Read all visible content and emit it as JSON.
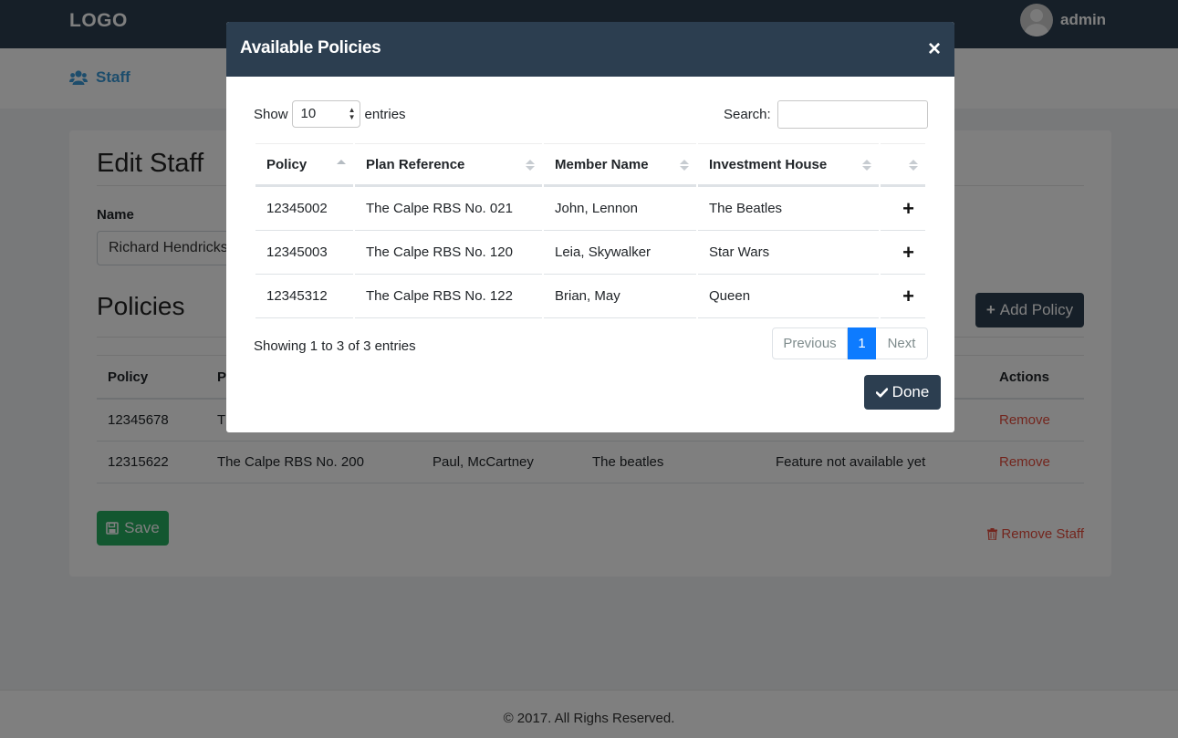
{
  "navbar": {
    "logo": "LOGO",
    "username": "admin"
  },
  "subnav": {
    "crumb_label": "Staff"
  },
  "edit": {
    "title": "Edit Staff",
    "name_label": "Name",
    "name_value": "Richard Hendricks",
    "policies_title": "Policies",
    "add_policy_label": "Add Policy",
    "table_headers": {
      "policy": "Policy",
      "plan_initial": "P",
      "actions": "Actions"
    },
    "rows": [
      {
        "policy": "12345678",
        "plan": "T",
        "member": "",
        "house": "",
        "status": "",
        "action": "Remove"
      },
      {
        "policy": "12315622",
        "plan": "The Calpe RBS No. 200",
        "member": "Paul, McCartney",
        "house": "The beatles",
        "status": "Feature not available yet",
        "action": "Remove"
      }
    ],
    "save_label": "Save",
    "remove_staff_label": "Remove Staff"
  },
  "footer": {
    "text": "© 2017. All Righs Reserved."
  },
  "modal": {
    "title": "Available Policies",
    "close_symbol": "×",
    "show_label": "Show",
    "entries_select": "10",
    "entries_label": "entries",
    "search_label": "Search:",
    "search_value": "",
    "columns": [
      "Policy",
      "Plan Reference",
      "Member Name",
      "Investment House",
      ""
    ],
    "rows": [
      {
        "policy": "12345002",
        "plan": "The Calpe RBS No. 021",
        "member": "John, Lennon",
        "house": "The Beatles",
        "add": "+"
      },
      {
        "policy": "12345003",
        "plan": "The Calpe RBS No. 120",
        "member": "Leia, Skywalker",
        "house": "Star Wars",
        "add": "+"
      },
      {
        "policy": "12345312",
        "plan": "The Calpe RBS No. 122",
        "member": "Brian, May",
        "house": "Queen",
        "add": "+"
      }
    ],
    "showing_text": "Showing 1 to 3 of 3 entries",
    "pagination": {
      "previous": "Previous",
      "current": "1",
      "next": "Next"
    },
    "done_label": "Done"
  },
  "colors": {
    "navbar": "#2c3e50",
    "link_blue": "#3a9ad9",
    "danger": "#e74c3c",
    "success": "#27ae60",
    "page_active": "#0d7bff"
  },
  "icons": {
    "crumb": "users-icon",
    "add_policy": "plus-icon",
    "save": "floppy-icon",
    "remove_staff": "trash-icon",
    "done": "check-icon",
    "close": "close-icon",
    "row_add": "plus-icon"
  }
}
